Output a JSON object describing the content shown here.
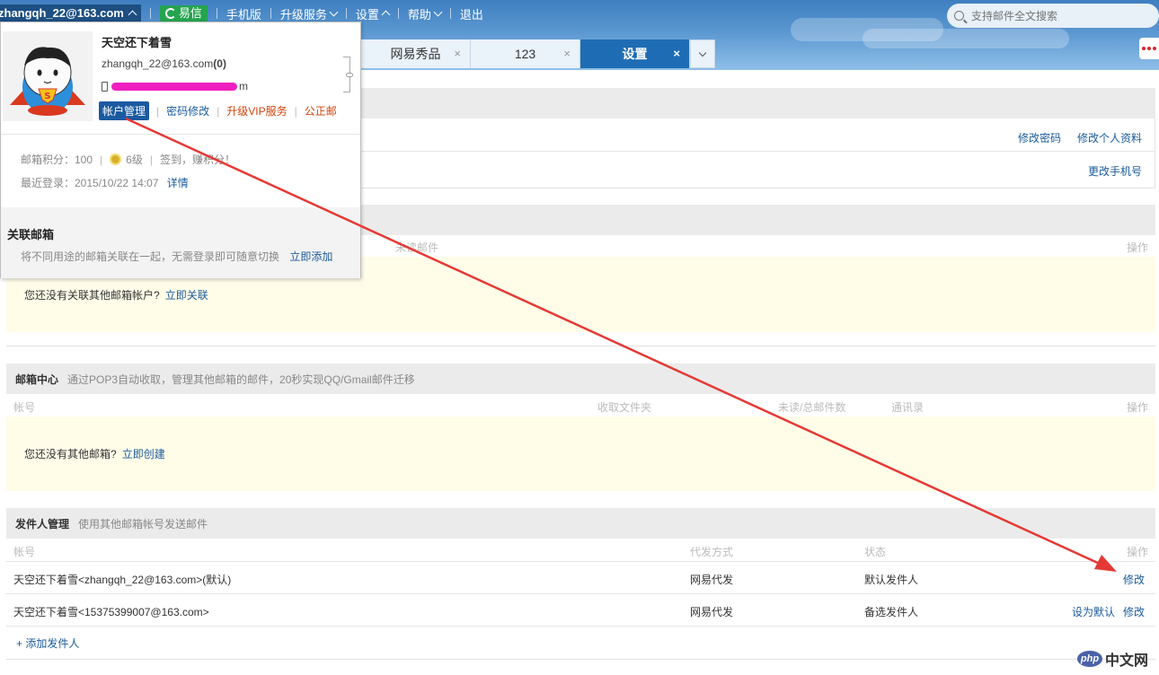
{
  "topnav": {
    "account": "zhangqh_22@163.com",
    "yixin": "易信",
    "mobile": "手机版",
    "upgrade": "升级服务",
    "settings": "设置",
    "help": "帮助",
    "logout": "退出"
  },
  "search": {
    "placeholder": "支持邮件全文搜索"
  },
  "tabs": [
    {
      "label": "网易秀品",
      "close": "×"
    },
    {
      "label": "123",
      "close": "×"
    },
    {
      "label": "设置",
      "close": "×",
      "active": true
    }
  ],
  "popup": {
    "name": "天空还下着雪",
    "email": "zhangqh_22@163.com",
    "email_count": "(0)",
    "phone_suffix": "m",
    "actions": {
      "account_mgmt": "帐户管理",
      "password": "密码修改",
      "vip": "升级VIP服务",
      "public": "公正邮"
    },
    "score": "邮箱积分：100",
    "level": "6级",
    "checkin": "签到，赚积分！",
    "last_login": "最近登录：2015/10/22 14:07",
    "detail": "详情",
    "linked_title": "关联邮箱",
    "linked_desc": "将不同用途的邮箱关联在一起，无需登录即可随意切换",
    "linked_add": "立即添加"
  },
  "account_section": {
    "change_password": "修改密码",
    "edit_profile": "修改个人资料",
    "change_phone": "更改手机号"
  },
  "linked_section": {
    "col_unread": "未读邮件",
    "col_action": "操作",
    "empty_text": "您还没有关联其他邮箱帐户?",
    "empty_link": "立即关联"
  },
  "mailbox_center": {
    "title": "邮箱中心",
    "desc": "通过POP3自动收取，管理其他邮箱的邮件，20秒实现QQ/Gmail邮件迁移",
    "cols": {
      "account": "帐号",
      "folder": "收取文件夹",
      "unread_total": "未读/总邮件数",
      "contacts": "通讯录",
      "action": "操作"
    },
    "empty_text": "您还没有其他邮箱?",
    "empty_link": "立即创建"
  },
  "sender_mgmt": {
    "title": "发件人管理",
    "desc": "使用其他邮箱帐号发送邮件",
    "cols": {
      "account": "帐号",
      "method": "代发方式",
      "status": "状态",
      "action": "操作"
    },
    "rows": [
      {
        "account": "天空还下着雪<zhangqh_22@163.com>(默认)",
        "method": "网易代发",
        "status": "默认发件人",
        "action2": "修改"
      },
      {
        "account": "天空还下着雪<15375399007@163.com>",
        "method": "网易代发",
        "status": "备选发件人",
        "action1": "设为默认",
        "action2": "修改"
      }
    ],
    "add_sender": "+ 添加发件人"
  },
  "watermark": {
    "php": "php",
    "text": "中文网"
  },
  "colors": {
    "accent": "#1e6db4",
    "link": "#1a5a9c",
    "arrow": "#e53935",
    "highlight": "#fffde8"
  }
}
